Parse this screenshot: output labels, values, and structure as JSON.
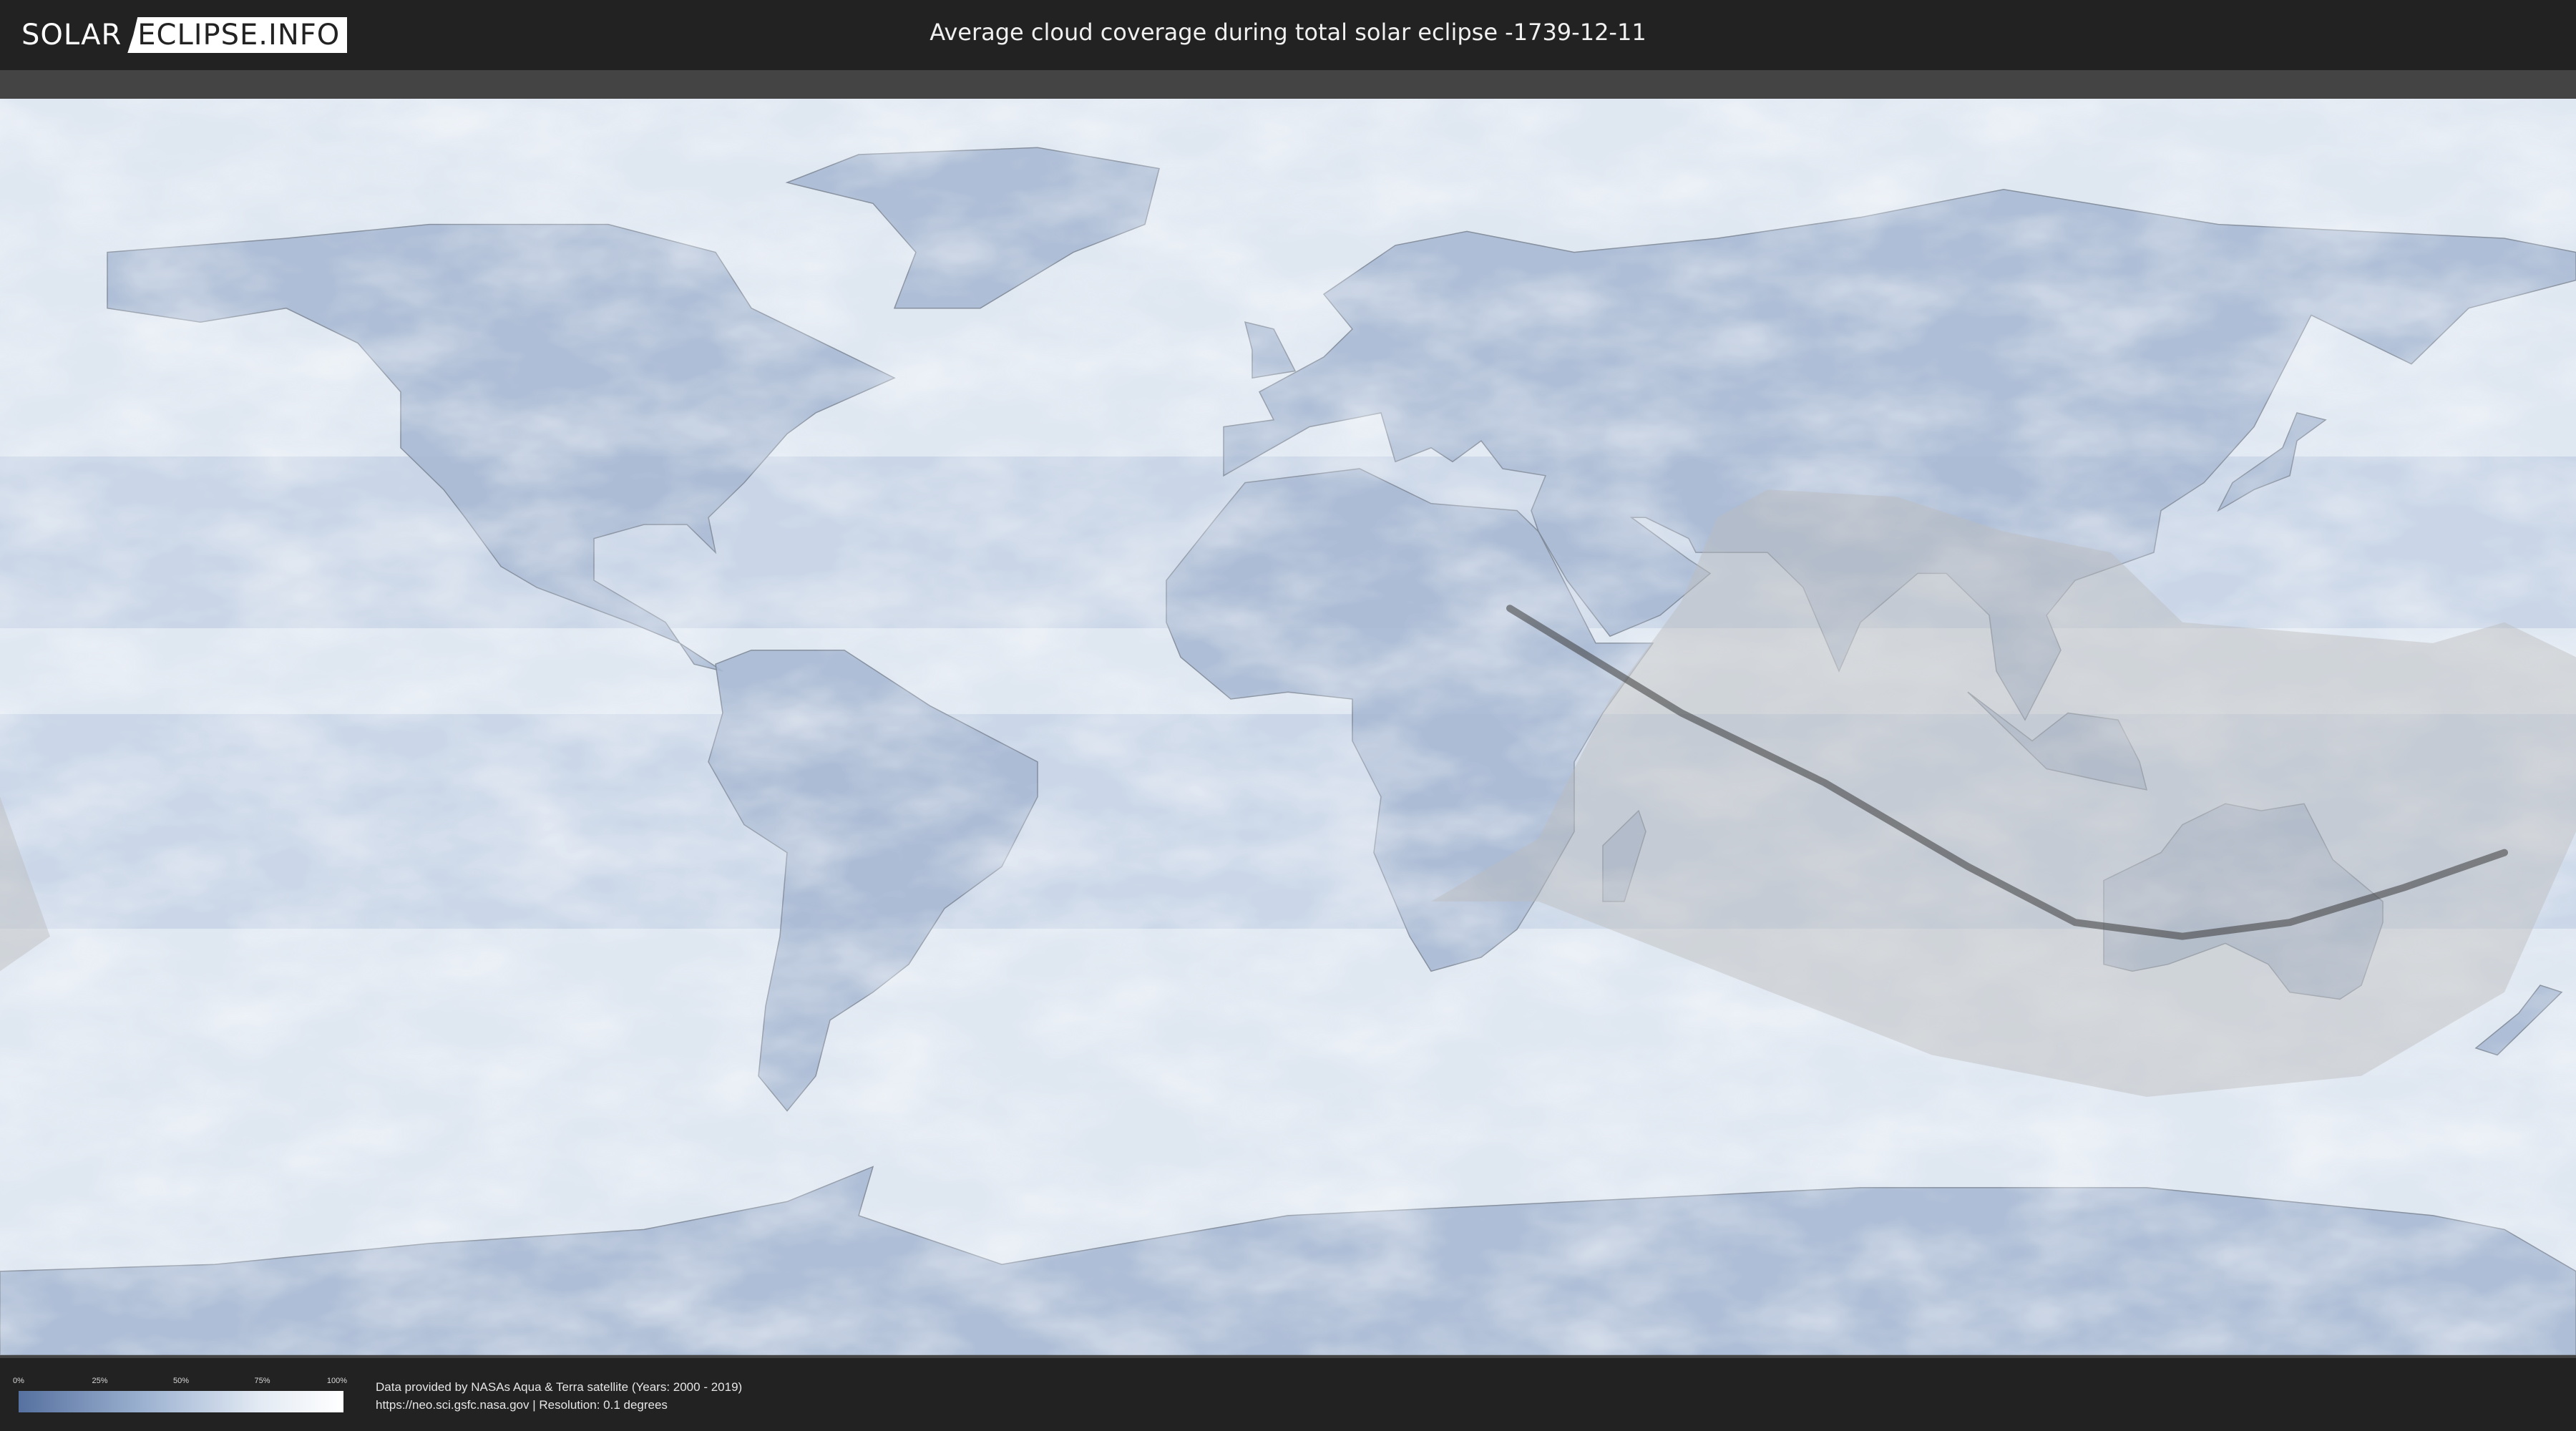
{
  "header": {
    "logo_part1": "SOLAR",
    "logo_part2": "ECLIPSE.INFO",
    "title": "Average cloud coverage during total solar eclipse -1739-12-11"
  },
  "legend": {
    "ticks": [
      "0%",
      "25%",
      "50%",
      "75%",
      "100%"
    ],
    "colors": [
      "#5671a0",
      "#9fb4d2",
      "#e4ebf4",
      "#ffffff"
    ]
  },
  "footer": {
    "line1": "Data provided by NASAs Aqua & Terra satellite (Years: 2000 - 2019)",
    "line2": "https://neo.sci.gsfc.nasa.gov | Resolution: 0.1 degrees"
  },
  "map": {
    "projection": "equirectangular",
    "ocean_color": "#dfe7f1",
    "land_color": "#a9bad4",
    "cloudy_color": "#f4f7fb",
    "clear_color": "#5f7aa8",
    "visibility_zone_color": "#bdbdbd",
    "central_line_color": "#3a3a3a",
    "central_line": [
      [
        31,
        17
      ],
      [
        55,
        2
      ],
      [
        75,
        -8
      ],
      [
        95,
        -20
      ],
      [
        110,
        -28
      ],
      [
        125,
        -30
      ],
      [
        140,
        -28
      ],
      [
        156,
        -23
      ],
      [
        170,
        -18
      ]
    ],
    "visibility_zone": [
      [
        20,
        -25
      ],
      [
        35,
        -16
      ],
      [
        45,
        4
      ],
      [
        55,
        18
      ],
      [
        60,
        30
      ],
      [
        67,
        34
      ],
      [
        85,
        33
      ],
      [
        100,
        28
      ],
      [
        115,
        25
      ],
      [
        125,
        15
      ],
      [
        160,
        12
      ],
      [
        170,
        15
      ],
      [
        180,
        10
      ],
      [
        180,
        -15
      ],
      [
        170,
        -38
      ],
      [
        150,
        -50
      ],
      [
        120,
        -53
      ],
      [
        90,
        -47
      ],
      [
        60,
        -35
      ],
      [
        35,
        -25
      ]
    ],
    "visibility_zone_west": [
      [
        -180,
        -10
      ],
      [
        -173,
        -30
      ],
      [
        -180,
        -35
      ]
    ]
  }
}
